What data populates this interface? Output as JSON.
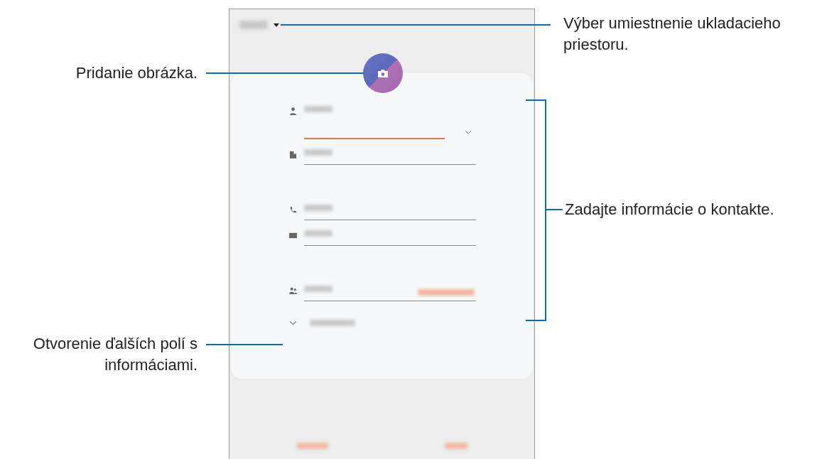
{
  "annotations": [
    {
      "kind": "storage",
      "text": "Výber umiestnenie ukladacieho priestoru."
    },
    {
      "kind": "picture",
      "text": "Pridanie obrázka."
    },
    {
      "kind": "info",
      "text": "Zadajte informácie o kontakte."
    },
    {
      "kind": "more",
      "text": "Otvorenie ďalších polí s informáciami."
    }
  ],
  "form": {
    "fields": [
      {
        "kind": "name",
        "focused": true
      },
      {
        "kind": "company",
        "focused": false
      },
      {
        "kind": "phone",
        "focused": false
      },
      {
        "kind": "email",
        "focused": false
      },
      {
        "kind": "groups",
        "focused": false
      }
    ]
  }
}
